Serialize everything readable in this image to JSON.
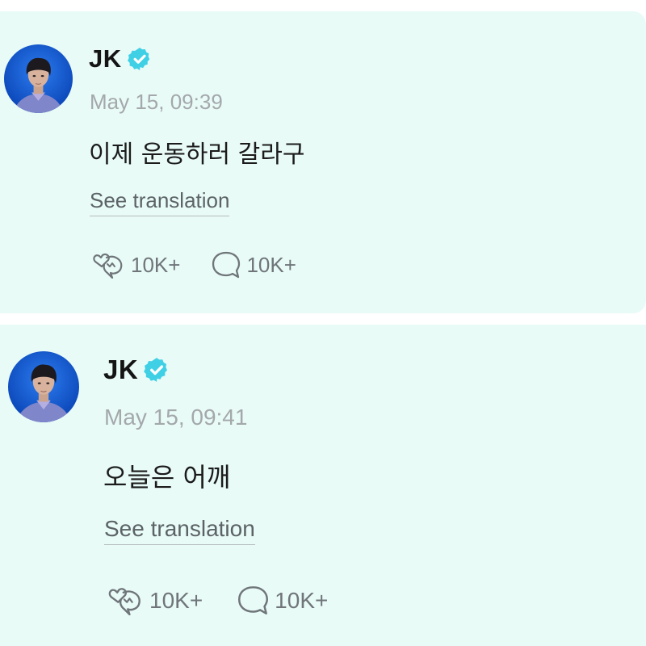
{
  "theme": {
    "card_background": "#e8fbf7",
    "verified_color": "#3fd0e6",
    "timestamp_color": "#a4a8ab",
    "action_color": "#6f7579"
  },
  "posts": [
    {
      "author": "JK",
      "verified_icon": "verified-badge-icon",
      "timestamp": "May 15, 09:39",
      "text": "이제 운동하러 갈라구",
      "translate_label": "See translation",
      "reactions": {
        "icon": "heart-wave-icon",
        "count": "10K+"
      },
      "comments": {
        "icon": "speech-bubble-icon",
        "count": "10K+"
      }
    },
    {
      "author": "JK",
      "verified_icon": "verified-badge-icon",
      "timestamp": "May 15, 09:41",
      "text": "오늘은 어깨",
      "translate_label": "See translation",
      "reactions": {
        "icon": "heart-wave-icon",
        "count": "10K+"
      },
      "comments": {
        "icon": "speech-bubble-icon",
        "count": "10K+"
      }
    }
  ]
}
